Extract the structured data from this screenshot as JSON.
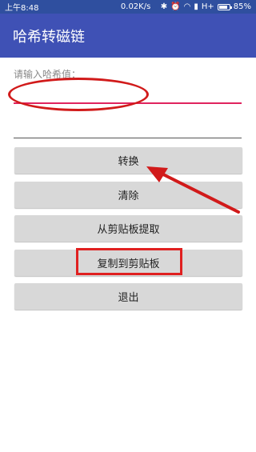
{
  "statusbar": {
    "time": "上午8:48",
    "net_speed": "0.02K/s",
    "signal": "H+",
    "battery": "85%",
    "battery_level": 0.85
  },
  "appbar": {
    "title": "哈希转磁链"
  },
  "form": {
    "hash_label": "请输入哈希值：",
    "hash_value": "",
    "result_value": ""
  },
  "buttons": {
    "convert": "转换",
    "clear": "清除",
    "paste": "从剪贴板提取",
    "copy": "复制到剪贴板",
    "exit": "退出"
  },
  "annotations": {
    "color": "#d11a1a"
  }
}
